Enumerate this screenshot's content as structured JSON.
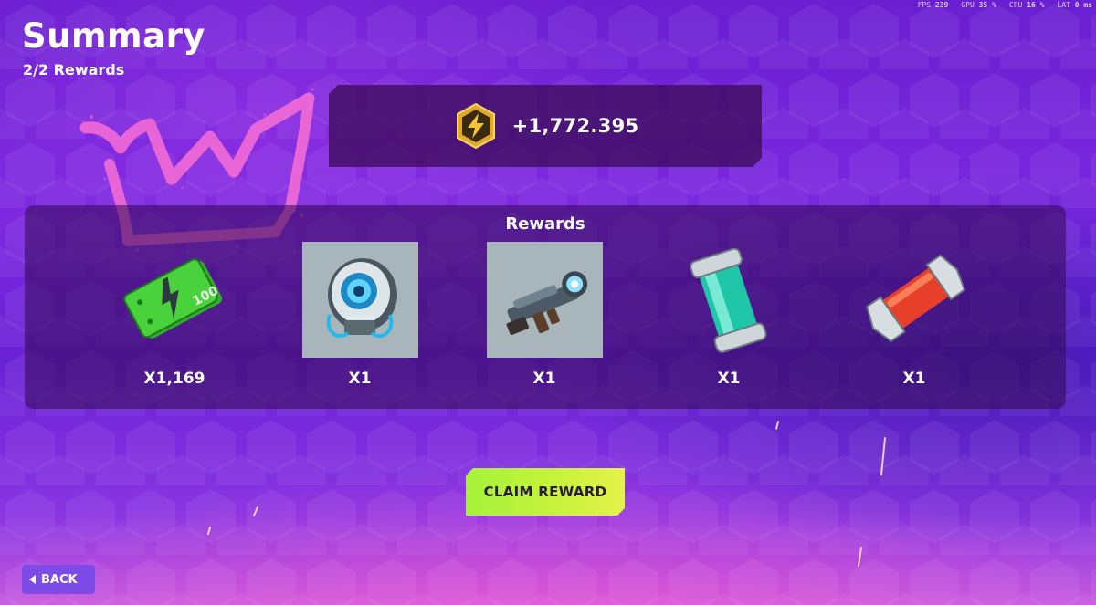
{
  "perf": [
    {
      "label": "FPS",
      "value": "239"
    },
    {
      "label": "GPU",
      "value": "35 %"
    },
    {
      "label": "CPU",
      "value": "16 %"
    },
    {
      "label": "LAT",
      "value": "0 ms"
    }
  ],
  "header": {
    "title": "Summary",
    "subtitle": "2/2 Rewards"
  },
  "currency": {
    "icon": "lightning-coin-icon",
    "amount": "+1,772.395"
  },
  "rewards": {
    "title": "Rewards",
    "items": [
      {
        "icon": "cash-bundle-icon",
        "quantity": "X1,169"
      },
      {
        "icon": "drone-gadget-icon",
        "quantity": "X1"
      },
      {
        "icon": "blaster-weapon-icon",
        "quantity": "X1"
      },
      {
        "icon": "green-canister-icon",
        "quantity": "X1"
      },
      {
        "icon": "red-canister-icon",
        "quantity": "X1"
      }
    ]
  },
  "actions": {
    "claim_label": "CLAIM REWARD",
    "back_label": "BACK"
  },
  "colors": {
    "accent_green": "#b6f33a",
    "back_button": "#7d4ce8",
    "crown_pink": "#f06ad6"
  }
}
